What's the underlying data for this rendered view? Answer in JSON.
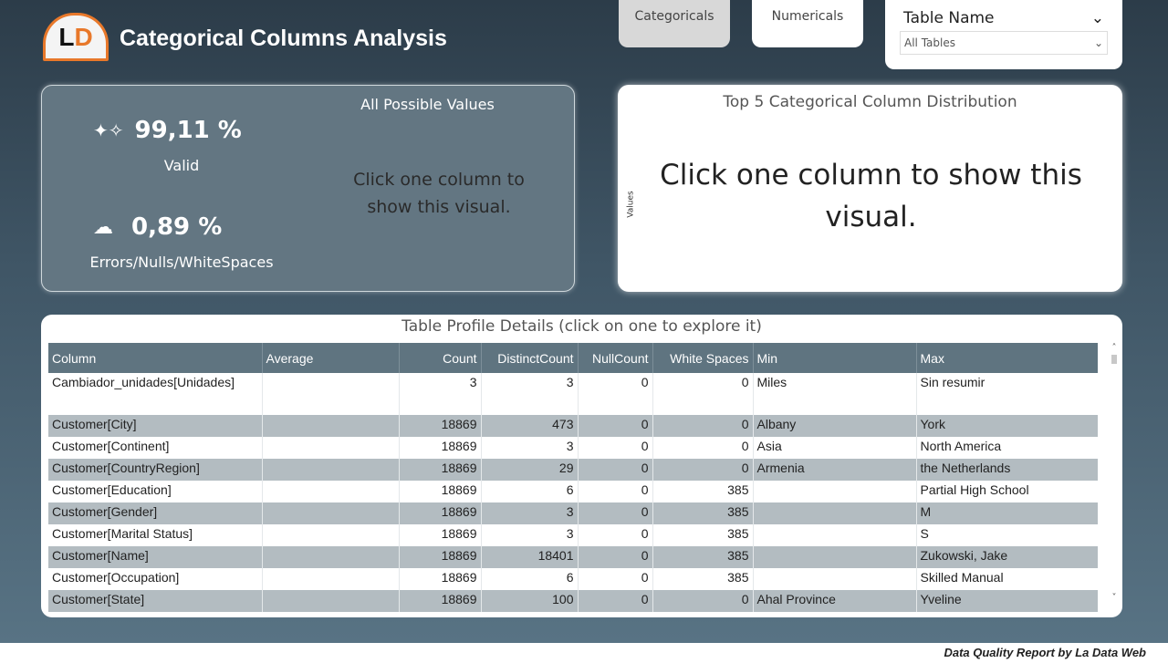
{
  "header": {
    "title": "Categorical Columns Analysis",
    "logo_text": "LD"
  },
  "nav": {
    "categoricals": "Categoricals",
    "numericals": "Numericals"
  },
  "slicer": {
    "label": "Table Name",
    "value": "All Tables"
  },
  "kpi": {
    "valid_value": "99,11 %",
    "valid_label": "Valid",
    "errors_value": "0,89 %",
    "errors_label": "Errors/Nulls/WhiteSpaces",
    "possible_title": "All Possible Values",
    "possible_msg": "Click one column to show this visual."
  },
  "distribution": {
    "title": "Top 5 Categorical Column Distribution",
    "axis_label": "Values",
    "msg": "Click one column to show this visual."
  },
  "table": {
    "title": "Table Profile Details (click on one to explore it)",
    "columns": [
      "Column",
      "Average",
      "Count",
      "DistinctCount",
      "NullCount",
      "White Spaces",
      "Min",
      "Max"
    ],
    "rows": [
      [
        "Cambiador_unidades[Unidades]",
        "",
        "3",
        "3",
        "0",
        "0",
        "Miles",
        "Sin resumir"
      ],
      [
        "Customer[City]",
        "",
        "18869",
        "473",
        "0",
        "0",
        "Albany",
        "York"
      ],
      [
        "Customer[Continent]",
        "",
        "18869",
        "3",
        "0",
        "0",
        "Asia",
        "North America"
      ],
      [
        "Customer[CountryRegion]",
        "",
        "18869",
        "29",
        "0",
        "0",
        "Armenia",
        "the Netherlands"
      ],
      [
        "Customer[Education]",
        "",
        "18869",
        "6",
        "0",
        "385",
        "",
        "Partial High School"
      ],
      [
        "Customer[Gender]",
        "",
        "18869",
        "3",
        "0",
        "385",
        "",
        "M"
      ],
      [
        "Customer[Marital Status]",
        "",
        "18869",
        "3",
        "0",
        "385",
        "",
        "S"
      ],
      [
        "Customer[Name]",
        "",
        "18869",
        "18401",
        "0",
        "385",
        "",
        "Zukowski, Jake"
      ],
      [
        "Customer[Occupation]",
        "",
        "18869",
        "6",
        "0",
        "385",
        "",
        "Skilled Manual"
      ],
      [
        "Customer[State]",
        "",
        "18869",
        "100",
        "0",
        "0",
        "Ahal Province",
        "Yveline"
      ]
    ]
  },
  "footer": "Data Quality Report by La Data Web",
  "colors": {
    "accent": "#e8782a",
    "header_row": "#5f7480",
    "alt_row": "#b3bcc1"
  }
}
